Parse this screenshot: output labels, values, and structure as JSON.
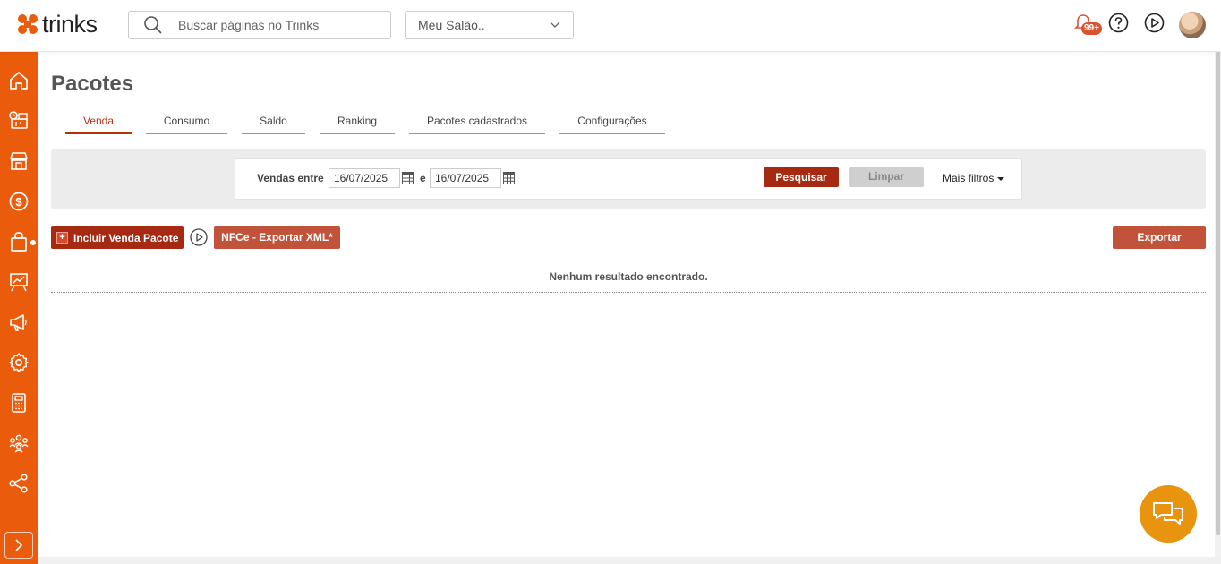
{
  "app": {
    "logo_text": "trinks",
    "brand_color": "#ea5b0c"
  },
  "search": {
    "placeholder": "Buscar páginas no Trinks"
  },
  "salon_select": {
    "selected": "Meu Salão.."
  },
  "header": {
    "notification_badge": "99+"
  },
  "sidebar": {
    "items": [
      {
        "icon": "home-icon"
      },
      {
        "icon": "agenda-icon"
      },
      {
        "icon": "store-icon"
      },
      {
        "icon": "money-icon"
      },
      {
        "icon": "shopping-bag-icon"
      },
      {
        "icon": "presentation-chart-icon"
      },
      {
        "icon": "megaphone-icon"
      },
      {
        "icon": "gear-icon"
      },
      {
        "icon": "calculator-icon"
      },
      {
        "icon": "team-icon"
      },
      {
        "icon": "share-icon"
      }
    ]
  },
  "page": {
    "title": "Pacotes"
  },
  "tabs": [
    {
      "label": "Venda",
      "active": true
    },
    {
      "label": "Consumo"
    },
    {
      "label": "Saldo"
    },
    {
      "label": "Ranking"
    },
    {
      "label": "Pacotes cadastrados"
    },
    {
      "label": "Configurações"
    }
  ],
  "filters": {
    "label": "Vendas entre",
    "date_from": "16/07/2025",
    "separator": "e",
    "date_to": "16/07/2025",
    "search_label": "Pesquisar",
    "clear_label": "Limpar",
    "more_label": "Mais filtros"
  },
  "actions": {
    "include_label": "Incluir Venda Pacote",
    "nfce_label": "NFCe - Exportar XML*",
    "export_label": "Exportar"
  },
  "results": {
    "empty_message": "Nenhum resultado encontrado."
  }
}
